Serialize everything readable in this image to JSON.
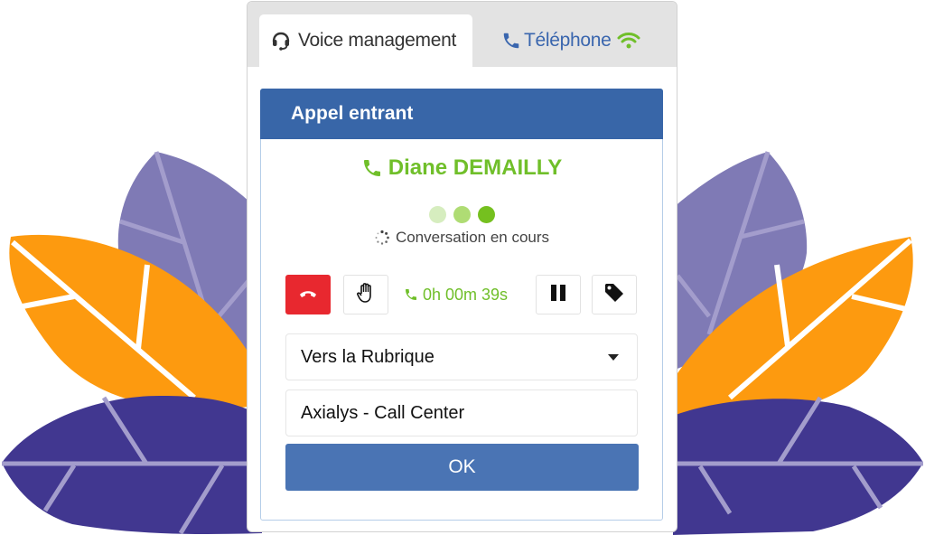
{
  "tabs": [
    {
      "label": "Voice management",
      "icon": "headset-icon",
      "active": true
    },
    {
      "label": "Téléphone",
      "icon": "phone-icon",
      "status_icon": "wifi-icon",
      "active": false
    }
  ],
  "panel": {
    "title": "Appel entrant",
    "caller_name": "Diane DEMAILLY",
    "status_text": "Conversation en cours",
    "timer": "0h 00m 39s",
    "buttons": {
      "hangup": "hangup-icon",
      "hold": "hand-icon",
      "pause": "pause-icon",
      "tag": "tag-icon"
    },
    "select": {
      "value": "Vers la Rubrique"
    },
    "input": {
      "value": "Axialys - Call Center"
    },
    "ok_label": "OK"
  },
  "colors": {
    "header_blue": "#3866a8",
    "ok_blue": "#4a74b4",
    "caller_green": "#70bf2a",
    "hangup_red": "#e8282f",
    "tab_text_blue": "#3a66ae",
    "leaf_orange": "#fd9a0f",
    "leaf_light_purple": "#7f7ab5",
    "leaf_dark_purple": "#413790"
  }
}
